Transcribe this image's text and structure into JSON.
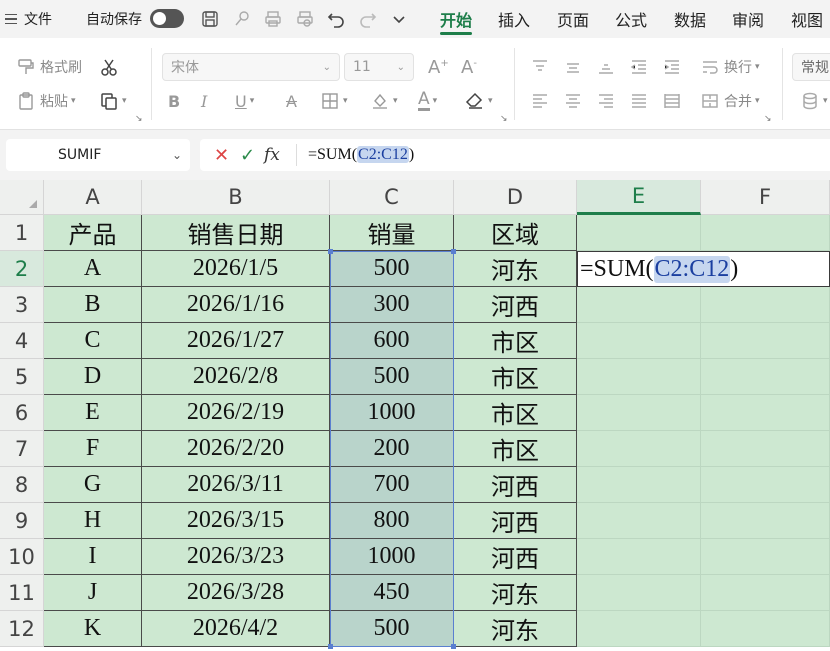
{
  "menubar": {
    "file_label": "文件",
    "autosave_label": "自动保存",
    "tabs": [
      "开始",
      "插入",
      "页面",
      "公式",
      "数据",
      "审阅",
      "视图"
    ],
    "active_tab": "开始"
  },
  "ribbon": {
    "format_painter_label": "格式刷",
    "paste_label": "粘贴",
    "font_name": "宋体",
    "font_size": "11",
    "wrap_label": "换行",
    "merge_label": "合并",
    "number_format": "常规"
  },
  "formula_bar": {
    "name_box": "SUMIF",
    "formula_prefix": "=SUM(",
    "formula_ref": "C2:C12",
    "formula_suffix": ")"
  },
  "sheet": {
    "columns": [
      "A",
      "B",
      "C",
      "D",
      "E",
      "F"
    ],
    "selected_column": "E",
    "selected_row": "2",
    "rows": [
      {
        "n": "1",
        "a": "产品",
        "b": "销售日期",
        "c": "销量",
        "d": "区域"
      },
      {
        "n": "2",
        "a": "A",
        "b": "2026/1/5",
        "c": "500",
        "d": "河东"
      },
      {
        "n": "3",
        "a": "B",
        "b": "2026/1/16",
        "c": "300",
        "d": "河西"
      },
      {
        "n": "4",
        "a": "C",
        "b": "2026/1/27",
        "c": "600",
        "d": "市区"
      },
      {
        "n": "5",
        "a": "D",
        "b": "2026/2/8",
        "c": "500",
        "d": "市区"
      },
      {
        "n": "6",
        "a": "E",
        "b": "2026/2/19",
        "c": "1000",
        "d": "市区"
      },
      {
        "n": "7",
        "a": "F",
        "b": "2026/2/20",
        "c": "200",
        "d": "市区"
      },
      {
        "n": "8",
        "a": "G",
        "b": "2026/3/11",
        "c": "700",
        "d": "河西"
      },
      {
        "n": "9",
        "a": "H",
        "b": "2026/3/15",
        "c": "800",
        "d": "河西"
      },
      {
        "n": "10",
        "a": "I",
        "b": "2026/3/23",
        "c": "1000",
        "d": "河西"
      },
      {
        "n": "11",
        "a": "J",
        "b": "2026/3/28",
        "c": "450",
        "d": "河东"
      },
      {
        "n": "12",
        "a": "K",
        "b": "2026/4/2",
        "c": "500",
        "d": "河东"
      }
    ],
    "edit_cell": {
      "prefix": "=SUM(",
      "ref": "C2:C12",
      "suffix": ")"
    }
  },
  "colors": {
    "accent": "#1e7e4a",
    "cell_fill": "#cde8d1",
    "range_fill": "#b9d4cb",
    "range_border": "#5a7fd0"
  }
}
